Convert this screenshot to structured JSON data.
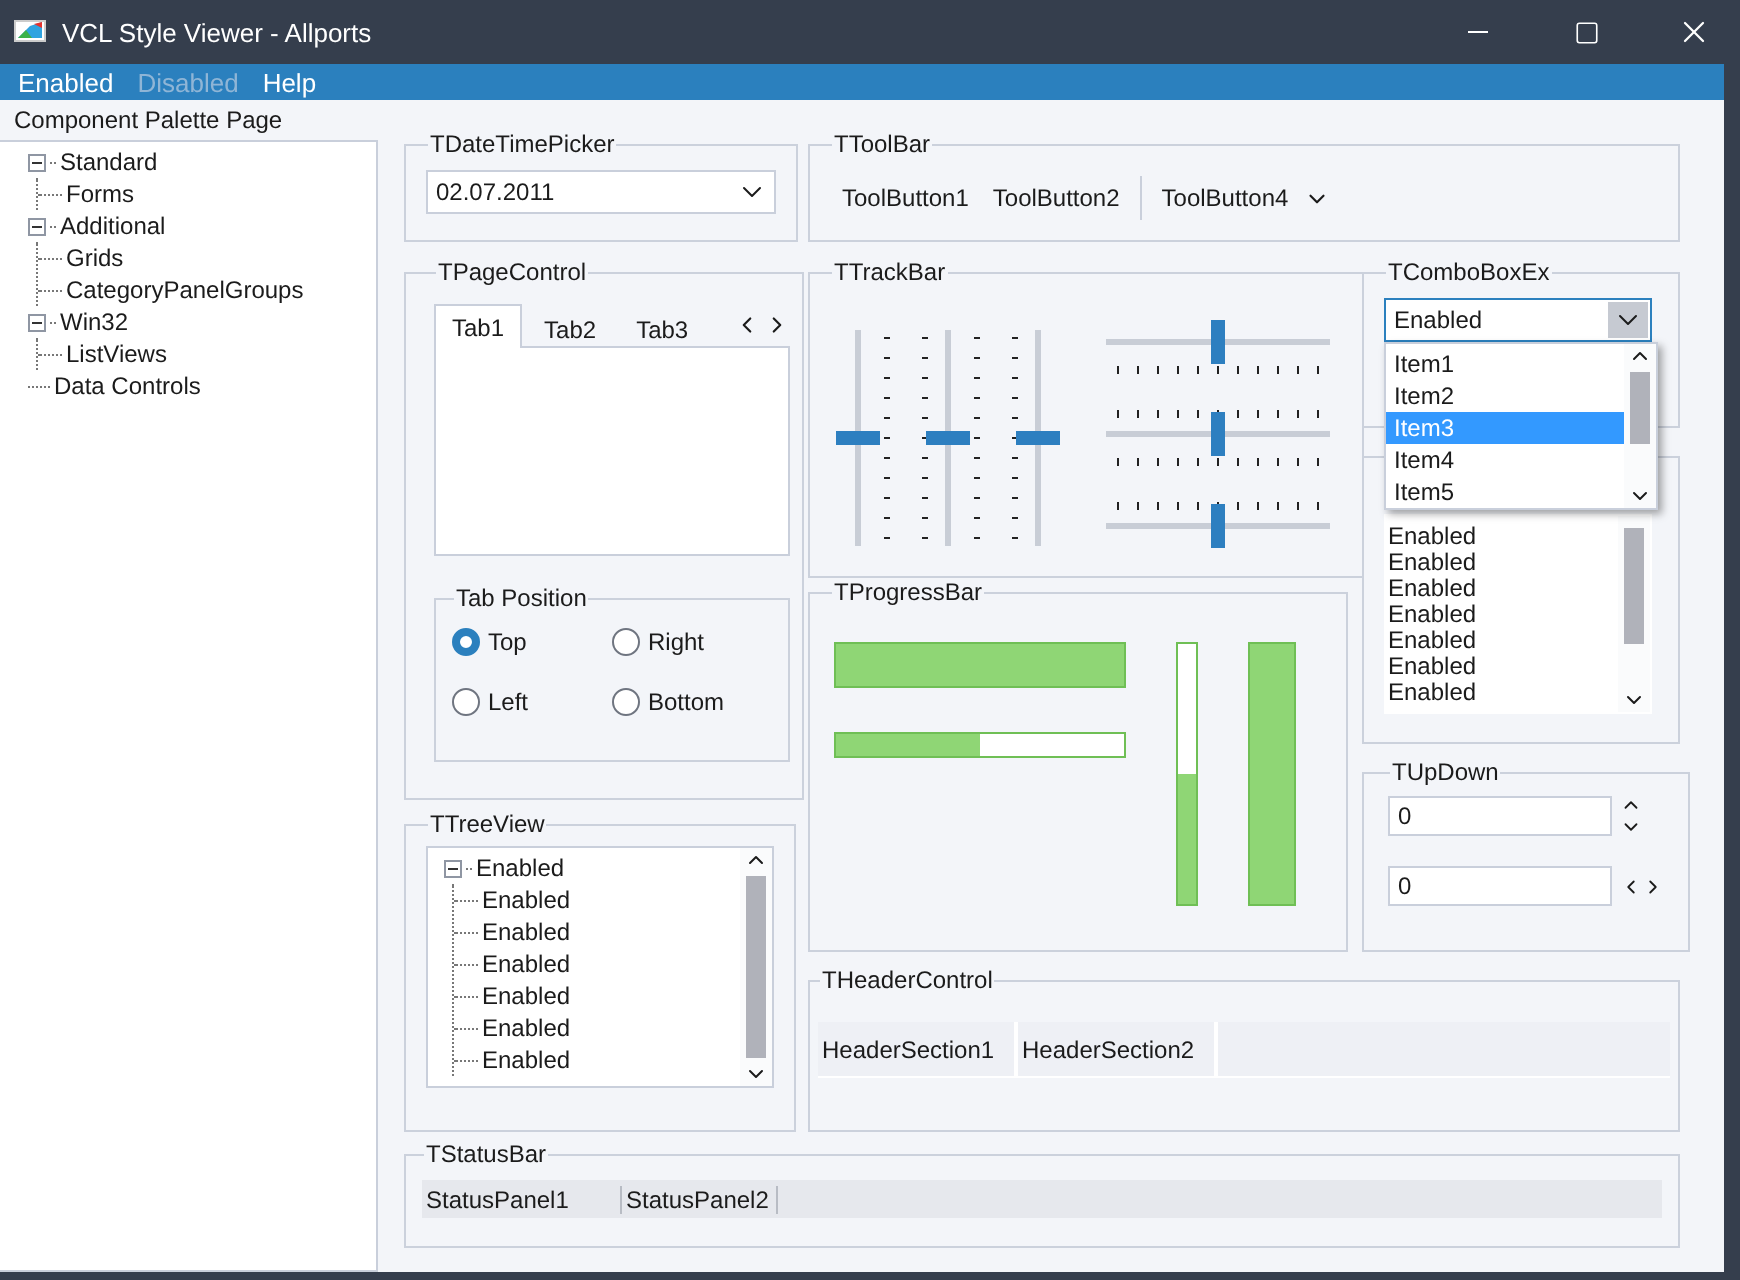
{
  "window": {
    "title": "VCL Style Viewer - Allports"
  },
  "menu": [
    {
      "label": "Enabled",
      "disabled": false
    },
    {
      "label": "Disabled",
      "disabled": true
    },
    {
      "label": "Help",
      "disabled": false
    }
  ],
  "palette": {
    "title": "Component Palette Page",
    "items": [
      {
        "label": "Standard",
        "expanded": true,
        "children": [
          {
            "label": "Forms"
          }
        ]
      },
      {
        "label": "Additional",
        "expanded": true,
        "children": [
          {
            "label": "Grids"
          },
          {
            "label": "CategoryPanelGroups"
          }
        ]
      },
      {
        "label": "Win32",
        "expanded": true,
        "children": [
          {
            "label": "ListViews"
          }
        ]
      },
      {
        "label": "Data Controls"
      }
    ]
  },
  "date_time_picker": {
    "title": "TDateTimePicker",
    "value": "02.07.2011"
  },
  "page_control": {
    "title": "TPageControl",
    "tabs": [
      {
        "label": "Tab1",
        "selected": true
      },
      {
        "label": "Tab2",
        "selected": false
      },
      {
        "label": "Tab3",
        "selected": false
      }
    ],
    "tab_position": {
      "title": "Tab Position",
      "options": [
        {
          "label": "Top",
          "selected": true
        },
        {
          "label": "Right",
          "selected": false
        },
        {
          "label": "Left",
          "selected": false
        },
        {
          "label": "Bottom",
          "selected": false
        }
      ]
    }
  },
  "tree_view": {
    "title": "TTreeView",
    "items": [
      {
        "label": "Enabled",
        "expanded": true,
        "children": [
          {
            "label": "Enabled"
          },
          {
            "label": "Enabled"
          },
          {
            "label": "Enabled"
          },
          {
            "label": "Enabled"
          },
          {
            "label": "Enabled"
          },
          {
            "label": "Enabled"
          }
        ]
      }
    ]
  },
  "toolbar": {
    "title": "TToolBar",
    "buttons": [
      {
        "kind": "button",
        "label": "ToolButton1"
      },
      {
        "kind": "button",
        "label": "ToolButton2"
      },
      {
        "kind": "separator"
      },
      {
        "kind": "dropdown",
        "label": "ToolButton4"
      }
    ]
  },
  "track_bar": {
    "title": "TTrackBar",
    "vertical_bars": [
      {
        "level": 0.5
      },
      {
        "level": 0.5
      },
      {
        "level": 0.5
      }
    ],
    "horizontal_bars": [
      {
        "level": 0.5
      },
      {
        "level": 0.5
      },
      {
        "level": 0.5
      }
    ]
  },
  "progress_bar": {
    "title": "TProgressBar",
    "bars": [
      {
        "kind": "horizontal",
        "level": 1
      },
      {
        "kind": "horizontal",
        "level": 0.5
      },
      {
        "kind": "vertical",
        "level": 0.5
      },
      {
        "kind": "vertical",
        "level": 1
      }
    ]
  },
  "combo_box_ex": {
    "title": "TComboBoxEx",
    "value": "Enabled",
    "expanded": true,
    "options": [
      {
        "label": "Item1",
        "selected": false
      },
      {
        "label": "Item2",
        "selected": false
      },
      {
        "label": "Item3",
        "selected": true
      },
      {
        "label": "Item4",
        "selected": false
      },
      {
        "label": "Item5",
        "selected": false
      }
    ]
  },
  "list_box": {
    "items": [
      "Enabled",
      "Enabled",
      "Enabled",
      "Enabled",
      "Enabled",
      "Enabled",
      "Enabled"
    ]
  },
  "up_down": {
    "title": "TUpDown",
    "fields": [
      {
        "kind": "vertical",
        "value": "0"
      },
      {
        "kind": "horizontal",
        "value": "0"
      }
    ]
  },
  "header_control": {
    "title": "THeaderControl",
    "sections": [
      "HeaderSection1",
      "HeaderSection2"
    ]
  },
  "status_bar": {
    "title": "TStatusBar",
    "panels": [
      "StatusPanel1",
      "StatusPanel2"
    ]
  }
}
